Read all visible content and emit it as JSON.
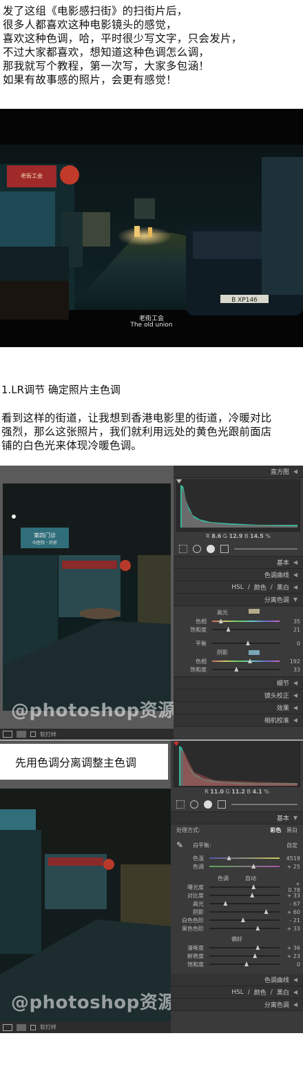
{
  "intro": {
    "lines": [
      "发了这组《电影感扫街》的扫街片后，",
      "很多人都喜欢这种电影镜头的感觉，",
      "喜欢这种色调，哈，平时很少写文字，只会发片，",
      "不过大家都喜欢，想知道这种色调怎么调，",
      "那我就写个教程，第一次写，大家多包涵！",
      "如果有故事感的照片，会更有感觉！"
    ]
  },
  "photo1": {
    "sign_text": "老街工会",
    "caption_cn": "老街工会",
    "caption_en": "The old union",
    "plate": "B XP146"
  },
  "section1": {
    "title": "1.LR调节 确定照片主色调",
    "body": [
      "看到这样的街道，让我想到香港电影里的街道，冷暖对比",
      "强烈，那么这张照片，我们就利用远处的黄色光跟前面店",
      "铺的白色光来体现冷暖色调。"
    ]
  },
  "lr1": {
    "histogram_title": "直方图",
    "readout": {
      "R": "8.6",
      "G": "12.9",
      "B": "14.5",
      "unit": "%"
    },
    "basic": "基本",
    "tone_curve": "色调曲线",
    "hsl_tabs": [
      "HSL",
      "颜色",
      "黑白"
    ],
    "split_toning": "分离色调",
    "highlights_label": "高光",
    "hue_label": "色相",
    "saturation_label": "饱和度",
    "balance_label": "平衡",
    "shadows_label": "阴影",
    "highlight_hue": "35",
    "highlight_sat": "21",
    "balance": "0",
    "shadow_hue": "192",
    "shadow_sat": "33",
    "detail": "细节",
    "lens": "镜头校正",
    "effects": "效果",
    "camera": "相机校准",
    "softproof": "软打样",
    "sign_store": "第四门诊",
    "sign_sub": "中医院・药房"
  },
  "callout": {
    "text": "先用色调分离调整主色调"
  },
  "lr2": {
    "readout": {
      "R": "11.0",
      "G": "11.2",
      "B": "4.1",
      "unit": "%"
    },
    "basic": "基本",
    "treatment_label": "处理方式:",
    "treatment_color": "彩色",
    "treatment_bw": "黑白",
    "wb_label": "白平衡:",
    "wb_value": "自定",
    "temp_label": "色温",
    "temp_value": "4519",
    "tint_label": "色调",
    "tint_value": "+ 25",
    "tone_label": "色调",
    "auto_label": "自动",
    "rows": [
      {
        "label": "曝光度",
        "value": "+ 0.78"
      },
      {
        "label": "对比度",
        "value": "+ 33"
      },
      {
        "label": "高光",
        "value": "- 67"
      },
      {
        "label": "阴影",
        "value": "+ 60"
      },
      {
        "label": "白色色阶",
        "value": "- 21"
      },
      {
        "label": "黑色色阶",
        "value": "+ 33"
      }
    ],
    "presence_label": "偏好",
    "presence_rows": [
      {
        "label": "清晰度",
        "value": "+ 36"
      },
      {
        "label": "鲜艳度",
        "value": "+ 23"
      },
      {
        "label": "饱和度",
        "value": "0"
      }
    ],
    "tone_curve": "色调曲线",
    "hsl_tabs": [
      "HSL",
      "颜色",
      "黑白"
    ],
    "split_toning": "分离色调",
    "softproof": "软打样"
  },
  "watermark": "@photoshop资源库"
}
